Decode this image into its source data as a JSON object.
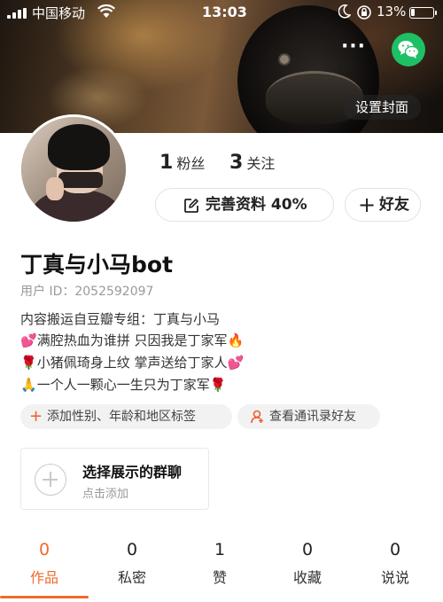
{
  "status_bar": {
    "carrier": "中国移动",
    "time": "13:03",
    "battery": "13%"
  },
  "cover": {
    "set_cover_label": "设置封面",
    "more_label": "···"
  },
  "stats": {
    "followers_count": "1",
    "followers_label": "粉丝",
    "following_count": "3",
    "following_label": "关注"
  },
  "actions": {
    "complete_profile": "完善资料 40%",
    "add_friend": "好友"
  },
  "profile": {
    "name": "丁真与小马bot",
    "user_id": "用户 ID：2052592097",
    "bio": [
      {
        "prefix": "",
        "text": "内容搬运自豆瓣专组：丁真与小马",
        "suffix": ""
      },
      {
        "prefix": "💕",
        "text": "满腔热血为谁拼 只因我是丁家军",
        "suffix": "🔥"
      },
      {
        "prefix": "🌹",
        "text": "小猪佩琦身上纹 掌声送给丁家人",
        "suffix": "💕"
      },
      {
        "prefix": "🙏",
        "text": "一个人一颗心一生只为丁家军",
        "suffix": "🌹"
      }
    ]
  },
  "tags": {
    "add_tags": "添加性别、年龄和地区标签",
    "contacts": "查看通讯录好友"
  },
  "group": {
    "title": "选择展示的群聊",
    "subtitle": "点击添加"
  },
  "tabs": [
    {
      "count": "0",
      "label": "作品",
      "active": true
    },
    {
      "count": "0",
      "label": "私密",
      "active": false
    },
    {
      "count": "1",
      "label": "赞",
      "active": false
    },
    {
      "count": "0",
      "label": "收藏",
      "active": false
    },
    {
      "count": "0",
      "label": "说说",
      "active": false
    }
  ],
  "colors": {
    "accent": "#f26a2b",
    "wechat": "#1ec065"
  },
  "icons": [
    "signal-icon",
    "wifi-icon",
    "moon-icon",
    "rotation-lock-icon",
    "battery-icon",
    "more-icon",
    "wechat-icon",
    "edit-icon",
    "plus-icon",
    "contacts-icon",
    "add-circle-icon"
  ]
}
